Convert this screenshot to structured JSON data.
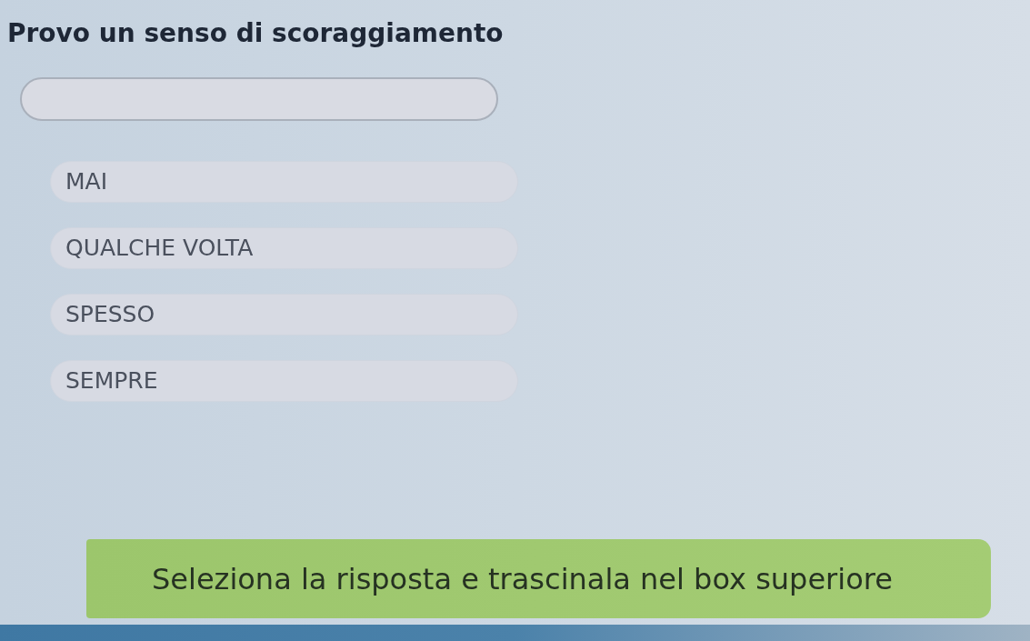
{
  "question": {
    "title": "Provo un senso di scoraggiamento"
  },
  "options": [
    {
      "label": "MAI"
    },
    {
      "label": "QUALCHE VOLTA"
    },
    {
      "label": "SPESSO"
    },
    {
      "label": "SEMPRE"
    }
  ],
  "instruction": "Seleziona la risposta e trascinala nel box superiore"
}
